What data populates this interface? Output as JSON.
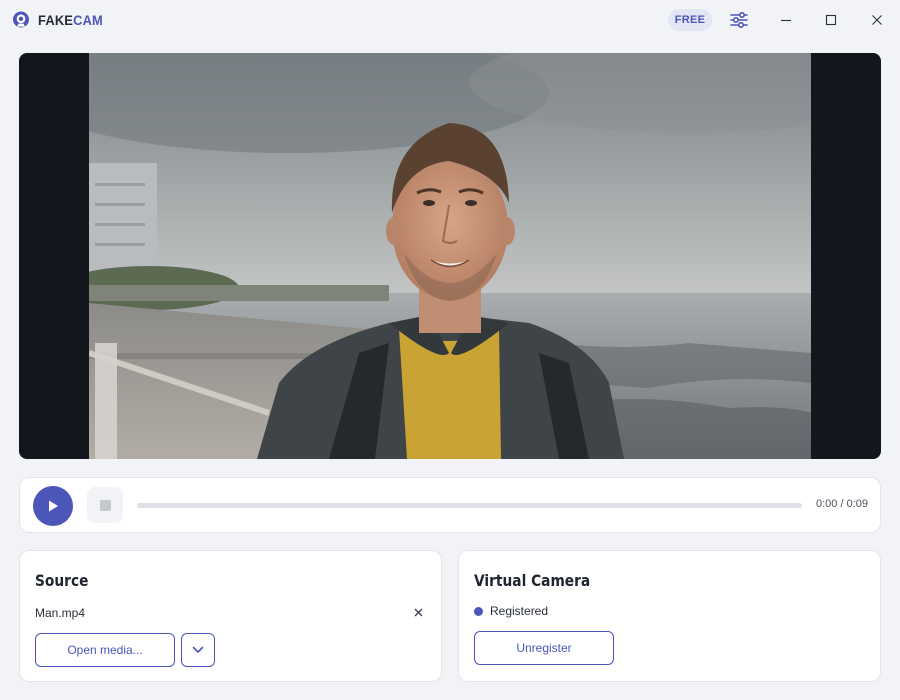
{
  "app": {
    "brand_part1": "FAKE",
    "brand_part2": "CAM",
    "plan_badge": "FREE",
    "icons": {
      "logo": "webcam-icon",
      "settings": "sliders-icon",
      "minimize": "minimize-icon",
      "maximize": "maximize-icon",
      "close": "close-icon"
    }
  },
  "colors": {
    "accent": "#4b56b8",
    "background": "#f2f3f6",
    "video_bg": "#14161e",
    "status": "#4b56b8"
  },
  "player": {
    "time": "0:00 / 0:09",
    "progress": 0.0,
    "icons": {
      "play": "play-icon",
      "stop": "stop-icon"
    }
  },
  "source": {
    "title": "Source",
    "file_name": "Man.mp4",
    "open_label": "Open media...",
    "icons": {
      "clear": "close-icon",
      "dropdown": "chevron-down-icon"
    }
  },
  "virtual_camera": {
    "title": "Virtual Camera",
    "status": "Registered",
    "unregister_label": "Unregister"
  }
}
